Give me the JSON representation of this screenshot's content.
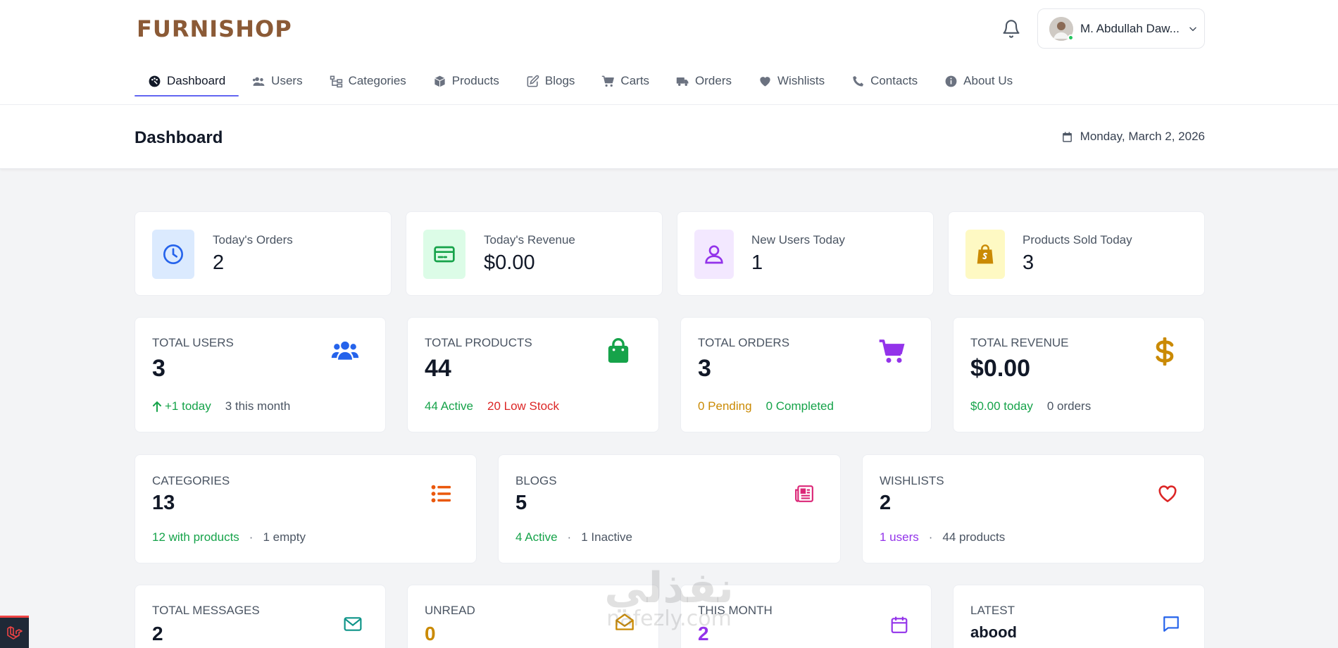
{
  "brand": "FURNISHOP",
  "user": {
    "name": "M. Abdullah Daw..."
  },
  "nav": [
    {
      "label": "Dashboard",
      "icon": "palette-icon",
      "active": true
    },
    {
      "label": "Users",
      "icon": "users-icon"
    },
    {
      "label": "Categories",
      "icon": "sitemap-icon"
    },
    {
      "label": "Products",
      "icon": "box-icon"
    },
    {
      "label": "Blogs",
      "icon": "pen-square-icon"
    },
    {
      "label": "Carts",
      "icon": "cart-icon"
    },
    {
      "label": "Orders",
      "icon": "truck-icon"
    },
    {
      "label": "Wishlists",
      "icon": "heart-icon"
    },
    {
      "label": "Contacts",
      "icon": "phone-icon"
    },
    {
      "label": "About Us",
      "icon": "info-icon"
    }
  ],
  "page": {
    "title": "Dashboard",
    "date": "Monday, March 2, 2026"
  },
  "today": [
    {
      "label": "Today's Orders",
      "value": "2",
      "icon": "clock-icon",
      "bg": "#dbeafe",
      "color": "#2563eb"
    },
    {
      "label": "Today's Revenue",
      "value": "$0.00",
      "icon": "credit-card-icon",
      "bg": "#dcfce7",
      "color": "#16a34a"
    },
    {
      "label": "New Users Today",
      "value": "1",
      "icon": "user-icon",
      "bg": "#f3e8ff",
      "color": "#9333ea"
    },
    {
      "label": "Products Sold Today",
      "value": "3",
      "icon": "shopify-bag-icon",
      "bg": "#fef9c3",
      "color": "#ca8a04"
    }
  ],
  "totals": {
    "users": {
      "label": "TOTAL USERS",
      "value": "3",
      "foot1": "+1 today",
      "foot2": "3 this month"
    },
    "products": {
      "label": "TOTAL PRODUCTS",
      "value": "44",
      "foot1": "44 Active",
      "foot2": "20 Low Stock"
    },
    "orders": {
      "label": "TOTAL ORDERS",
      "value": "3",
      "foot1": "0 Pending",
      "foot2": "0 Completed"
    },
    "revenue": {
      "label": "TOTAL REVENUE",
      "value": "$0.00",
      "foot1": "$0.00 today",
      "foot2": "0 orders"
    }
  },
  "sections": {
    "categories": {
      "label": "CATEGORIES",
      "value": "13",
      "foot1": "12 with products",
      "sep": "·",
      "foot2": "1 empty"
    },
    "blogs": {
      "label": "BLOGS",
      "value": "5",
      "foot1": "4 Active",
      "sep": "·",
      "foot2": "1 Inactive"
    },
    "wishlists": {
      "label": "WISHLISTS",
      "value": "2",
      "foot1": "1 users",
      "sep": "·",
      "foot2": "44 products"
    }
  },
  "messages": {
    "total": {
      "label": "TOTAL MESSAGES",
      "value": "2"
    },
    "unread": {
      "label": "UNREAD",
      "value": "0"
    },
    "month": {
      "label": "THIS MONTH",
      "value": "2"
    },
    "latest": {
      "label": "LATEST",
      "value": "abood"
    }
  },
  "watermark": {
    "ar": "نفذلي",
    "en": "nafezly.com"
  },
  "colors": {
    "accent": "#6366f1",
    "brand": "#8b5a36"
  }
}
